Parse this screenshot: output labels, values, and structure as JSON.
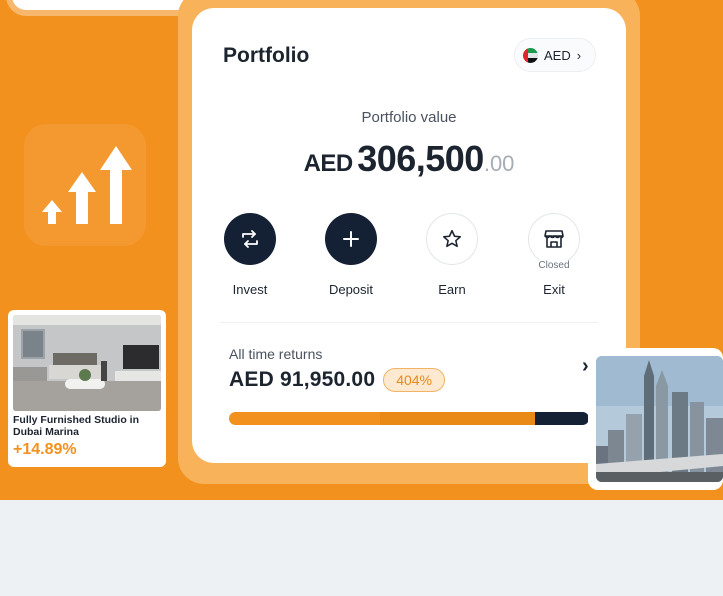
{
  "portfolio": {
    "title": "Portfolio",
    "currency": {
      "code": "AED",
      "flag_icon": "uae-flag-icon",
      "chevron": "›"
    },
    "value_label": "Portfolio value",
    "value_currency": "AED",
    "value_main": "306,500",
    "value_decimal": ".00",
    "actions": [
      {
        "label": "Invest",
        "icon": "swap-icon",
        "style": "dark"
      },
      {
        "label": "Deposit",
        "icon": "plus-icon",
        "style": "dark"
      },
      {
        "label": "Earn",
        "icon": "star-icon",
        "style": "light"
      },
      {
        "label": "Exit",
        "icon": "store-icon",
        "style": "light",
        "tag": "Closed"
      }
    ],
    "returns": {
      "label": "All time returns",
      "value": "AED 91,950.00",
      "percent": "404%",
      "chevron": "›",
      "bar_fractions": [
        0.42,
        0.43,
        0.15
      ]
    }
  },
  "property": {
    "title": "Fully Furnished Studio in Dubai Marina",
    "change": "+14.89%"
  },
  "colors": {
    "brand_orange": "#f3911f",
    "navy": "#142033",
    "badge_bg": "#fde9cf"
  }
}
